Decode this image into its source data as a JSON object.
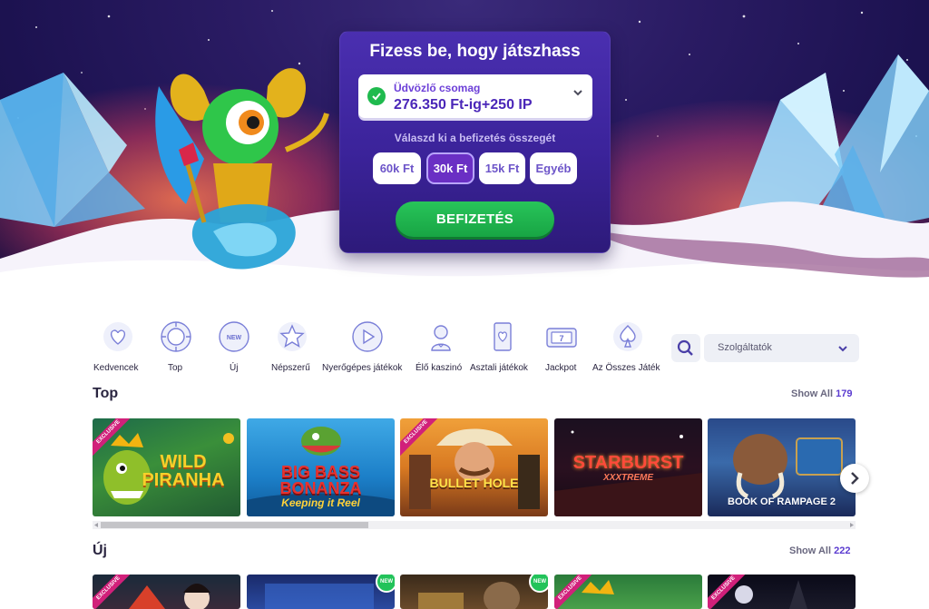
{
  "deposit": {
    "title": "Fizess be, hogy játszhass",
    "bonus_label": "Üdvözlő csomag",
    "bonus_value": "276.350 Ft-ig+250 IP",
    "amount_label": "Válaszd ki a befizetés összegét",
    "amounts": [
      "60k Ft",
      "30k Ft",
      "15k Ft",
      "Egyéb"
    ],
    "selected_amount": "30k Ft",
    "button_label": "BEFIZETÉS"
  },
  "categories": [
    {
      "label": "Kedvencek",
      "icon": "heart-icon"
    },
    {
      "label": "Top",
      "icon": "chip-icon"
    },
    {
      "label": "Új",
      "icon": "new-badge-icon"
    },
    {
      "label": "Népszerű",
      "icon": "star-icon"
    },
    {
      "label": "Nyerőgépes játékok",
      "icon": "play-icon"
    },
    {
      "label": "Élő kaszinó",
      "icon": "dealer-icon"
    },
    {
      "label": "Asztali játékok",
      "icon": "card-icon"
    },
    {
      "label": "Jackpot",
      "icon": "slot-777-icon"
    },
    {
      "label": "Az Összes Játék",
      "icon": "spade-icon"
    }
  ],
  "search": {
    "icon": "search-icon"
  },
  "provider_select": {
    "placeholder": "Szolgáltatók"
  },
  "sections": {
    "top": {
      "title": "Top",
      "show_all_label": "Show All",
      "count": "179",
      "games": [
        {
          "name": "WILD PIRANHA",
          "exclusive": "EXCLUSIVE"
        },
        {
          "name": "BIG BASS BONANZA",
          "subtitle": "Keeping it Reel"
        },
        {
          "name": "BULLET HOLE",
          "exclusive": "EXCLUSIVE"
        },
        {
          "name": "STARBURST",
          "subtitle": "XXXTREME"
        },
        {
          "name": "BOOK OF RAMPAGE 2"
        }
      ]
    },
    "new": {
      "title": "Új",
      "show_all_label": "Show All",
      "count": "222",
      "badges": {
        "exclusive": "EXCLUSIVE",
        "new": "NEW"
      }
    }
  },
  "colors": {
    "accent_purple": "#5b3bd0",
    "cta_green": "#1fb14f",
    "card_bg": "#3b239a",
    "exclusive_pink": "#d1207a"
  }
}
